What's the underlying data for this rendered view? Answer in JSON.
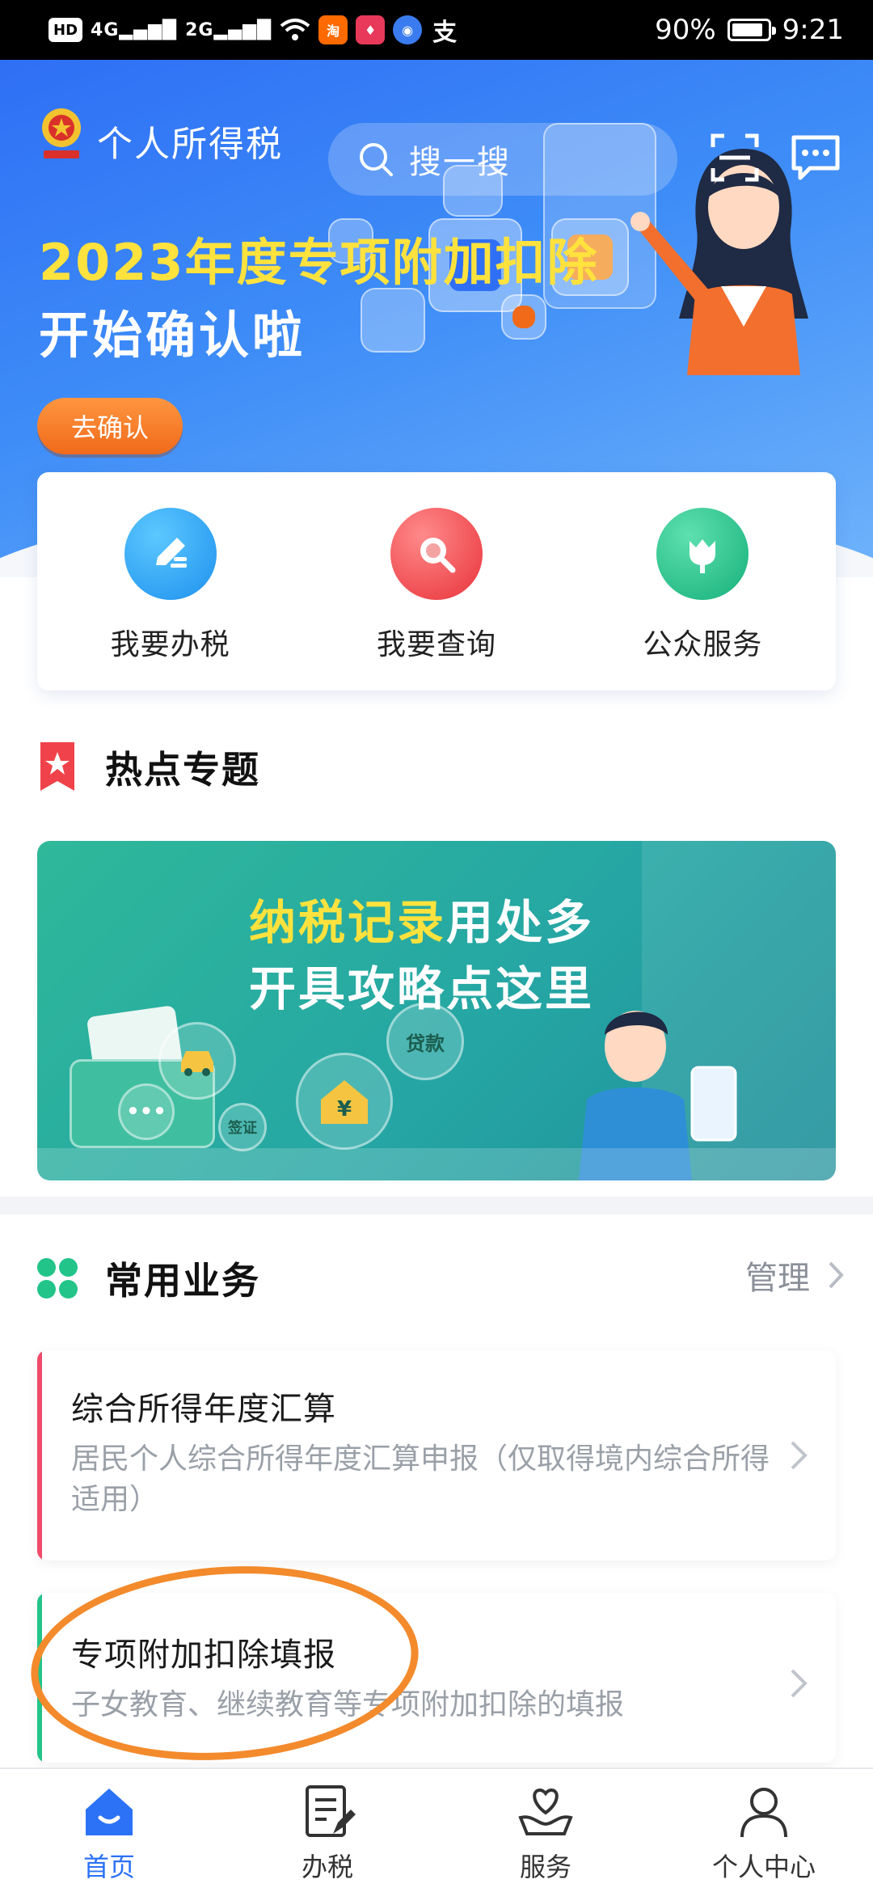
{
  "status_bar": {
    "network": "4G",
    "network2": "2G",
    "apps": [
      "淘",
      "支"
    ],
    "battery": "90%",
    "battery_level": 0.9,
    "time": "9:21"
  },
  "header": {
    "app_title": "个人所得税",
    "search_placeholder": "搜一搜",
    "icons": [
      "emblem-icon",
      "scan-icon",
      "message-icon"
    ]
  },
  "banner": {
    "year": "2023",
    "highlight_title": "年度专项附加扣除",
    "subtitle": "开始确认啦",
    "button": "去确认",
    "dot_count": 5,
    "active_dot": 0,
    "colors": {
      "gradient_start": "#2f6ff5",
      "gradient_end": "#6fb3fb",
      "accent": "#ffe23d",
      "button": "#f06a1a"
    }
  },
  "quick_actions": [
    {
      "label": "我要办税",
      "icon": "edit-icon",
      "color": "#2aa6f2"
    },
    {
      "label": "我要查询",
      "icon": "search-icon",
      "color": "#f05252"
    },
    {
      "label": "公众服务",
      "icon": "tulip-icon",
      "color": "#22c48a"
    }
  ],
  "hot_topics": {
    "title": "热点专题",
    "banner_line1_highlight": "纳税记录",
    "banner_line1_rest": "用处多",
    "banner_line2": "开具攻略点这里",
    "bubble_labels": [
      "贷款",
      "签证",
      "¥"
    ]
  },
  "common_services": {
    "title": "常用业务",
    "manage": "管理",
    "items": [
      {
        "title": "综合所得年度汇算",
        "desc": "居民个人综合所得年度汇算申报（仅取得境内综合所得适用）",
        "accent": "#f04b6b"
      },
      {
        "title": "专项附加扣除填报",
        "desc": "子女教育、继续教育等专项附加扣除的填报",
        "accent": "#22c48a"
      }
    ]
  },
  "tabbar": {
    "items": [
      {
        "label": "首页",
        "icon": "home-icon",
        "active": true
      },
      {
        "label": "办税",
        "icon": "document-icon",
        "active": false
      },
      {
        "label": "服务",
        "icon": "heart-hand-icon",
        "active": false
      },
      {
        "label": "个人中心",
        "icon": "user-icon",
        "active": false
      }
    ]
  }
}
